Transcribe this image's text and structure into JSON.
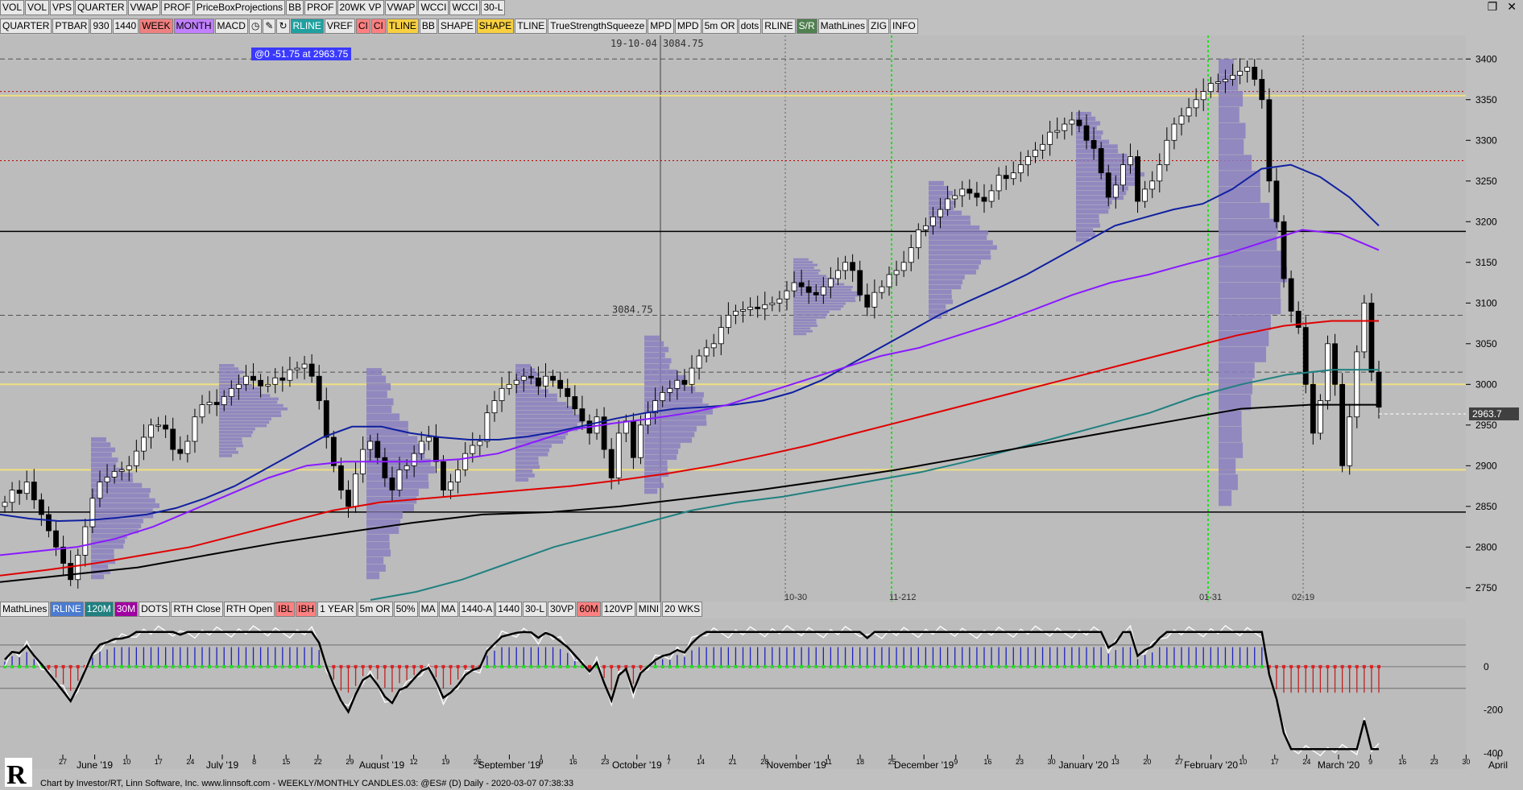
{
  "toolbar1": [
    "VOL",
    "VOL",
    "VPS",
    "QUARTER",
    "VWAP",
    "PROF",
    "PriceBoxProjections",
    "BB",
    "PROF",
    "20WK VP",
    "VWAP",
    "WCCI",
    "WCCI",
    "30-L"
  ],
  "toolbar2": [
    {
      "label": "QUARTER"
    },
    {
      "label": "PTBAR"
    },
    {
      "label": "930"
    },
    {
      "label": "1440"
    },
    {
      "label": "WEEK",
      "style": "c-red"
    },
    {
      "label": "MONTH",
      "style": "c-violet"
    },
    {
      "label": "MACD"
    },
    {
      "label": "clock-icon",
      "icon": "◷"
    },
    {
      "label": "pencil-icon",
      "icon": "✎"
    },
    {
      "label": "refresh-icon",
      "icon": "↻"
    },
    {
      "label": "RLINE",
      "style": "c-teal"
    },
    {
      "label": "VREF"
    },
    {
      "label": "CI",
      "style": "c-pink"
    },
    {
      "label": "CI",
      "style": "c-pink"
    },
    {
      "label": "TLINE",
      "style": "c-yellow"
    },
    {
      "label": "BB"
    },
    {
      "label": "SHAPE"
    },
    {
      "label": "SHAPE",
      "style": "c-yellow"
    },
    {
      "label": "TLINE"
    },
    {
      "label": "TrueStrengthSqueeze"
    },
    {
      "label": "MPD"
    },
    {
      "label": "MPD"
    },
    {
      "label": "5m OR"
    },
    {
      "label": "dots"
    },
    {
      "label": "RLINE"
    },
    {
      "label": "S/R",
      "style": "c-green"
    },
    {
      "label": "MathLines"
    },
    {
      "label": "ZIG"
    },
    {
      "label": "INFO"
    }
  ],
  "toolbar3": [
    {
      "label": "MathLines"
    },
    {
      "label": "RLINE",
      "style": "c-blue"
    },
    {
      "label": "120M",
      "style": "c-darkteal"
    },
    {
      "label": "30M",
      "style": "c-purple"
    },
    {
      "label": "DOTS"
    },
    {
      "label": "RTH Close"
    },
    {
      "label": "RTH Open"
    },
    {
      "label": "IBL",
      "style": "c-pink"
    },
    {
      "label": "IBH",
      "style": "c-pink"
    },
    {
      "label": "1 YEAR"
    },
    {
      "label": "5m OR"
    },
    {
      "label": "50%"
    },
    {
      "label": "MA"
    },
    {
      "label": "MA"
    },
    {
      "label": "1440-A"
    },
    {
      "label": "1440"
    },
    {
      "label": "30-L"
    },
    {
      "label": "30VP"
    },
    {
      "label": "60M",
      "style": "c-pink"
    },
    {
      "label": "120VP"
    },
    {
      "label": "MINI"
    },
    {
      "label": "20 WKS"
    }
  ],
  "info_badge": "@0  -51.75 at 2963.75",
  "cursor_label": "19-10-04  3084.75",
  "level_label": "3084.75",
  "current_price": "2963.7",
  "footer": "Chart by Investor/RT, Linn Software, Inc. www.linnsoft.com - WEEKLY/MONTHLY CANDLES.03: @ES# (D) Daily - 2020-03-07 07:38:33",
  "markers": [
    "10-30",
    "11-212",
    "01-31",
    "02-19"
  ],
  "colors": {
    "ma_blue": "#1020a0",
    "ma_violet": "#8a1aff",
    "ma_red": "#e00000",
    "ma_teal": "#208080",
    "ma_black": "#000000",
    "profile": "#8a7fc0",
    "guide_green": "#20e020"
  },
  "chart_data": [
    {
      "type": "candlestick",
      "title": "",
      "ylim": [
        2735,
        3425
      ],
      "yticks": [
        3400,
        3350,
        3300,
        3250,
        3200,
        3150,
        3100,
        3050,
        3000,
        2950,
        2900,
        2850,
        2800,
        2750
      ],
      "day_labels": [
        "27",
        "June '19",
        "10",
        "17",
        "24",
        "July '19",
        "8",
        "15",
        "22",
        "29",
        "August '19",
        "12",
        "19",
        "26",
        "September '19",
        "9",
        "16",
        "23",
        "October '19",
        "7",
        "14",
        "21",
        "28",
        "November '19",
        "11",
        "18",
        "25",
        "December '19",
        "9",
        "16",
        "23",
        "30",
        "January '20",
        "13",
        "20",
        "27",
        "February '20",
        "10",
        "17",
        "24",
        "March '20",
        "9",
        "16",
        "23",
        "30",
        "April"
      ],
      "closes": [
        2855,
        2870,
        2866,
        2880,
        2858,
        2840,
        2820,
        2800,
        2780,
        2760,
        2790,
        2825,
        2860,
        2880,
        2886,
        2893,
        2895,
        2900,
        2918,
        2935,
        2950,
        2950,
        2945,
        2920,
        2915,
        2930,
        2960,
        2975,
        2978,
        2975,
        2985,
        2995,
        3000,
        3010,
        3005,
        2998,
        3000,
        3008,
        3005,
        3018,
        3020,
        3025,
        3010,
        2980,
        2935,
        2900,
        2870,
        2850,
        2890,
        2920,
        2930,
        2910,
        2885,
        2870,
        2895,
        2900,
        2915,
        2930,
        2935,
        2905,
        2870,
        2880,
        2895,
        2915,
        2925,
        2930,
        2965,
        2980,
        2995,
        3000,
        3005,
        3010,
        3008,
        2998,
        3010,
        3005,
        2995,
        2985,
        2970,
        2955,
        2940,
        2960,
        2920,
        2885,
        2940,
        2955,
        2910,
        2950,
        2965,
        2980,
        2990,
        2995,
        3005,
        3000,
        3020,
        3035,
        3045,
        3050,
        3070,
        3085,
        3090,
        3092,
        3095,
        3093,
        3098,
        3100,
        3105,
        3115,
        3125,
        3120,
        3113,
        3110,
        3120,
        3130,
        3140,
        3150,
        3140,
        3110,
        3095,
        3113,
        3120,
        3135,
        3140,
        3150,
        3168,
        3190,
        3195,
        3206,
        3215,
        3228,
        3232,
        3240,
        3235,
        3230,
        3225,
        3238,
        3257,
        3253,
        3260,
        3270,
        3280,
        3288,
        3295,
        3310,
        3312,
        3320,
        3325,
        3318,
        3300,
        3290,
        3260,
        3230,
        3245,
        3270,
        3280,
        3225,
        3240,
        3250,
        3270,
        3300,
        3320,
        3330,
        3340,
        3350,
        3360,
        3370,
        3372,
        3375,
        3380,
        3385,
        3390,
        3375,
        3350,
        3250,
        3200,
        3130,
        3090,
        3070,
        3000,
        2940,
        2980,
        3050,
        3000,
        2900,
        2960,
        3040,
        3100,
        3015,
        2972
      ],
      "ma_blue": [
        2840,
        2835,
        2832,
        2833,
        2836,
        2840,
        2848,
        2860,
        2875,
        2895,
        2915,
        2935,
        2948,
        2948,
        2940,
        2935,
        2932,
        2932,
        2936,
        2942,
        2950,
        2958,
        2965,
        2970,
        2972,
        2975,
        2980,
        2990,
        3005,
        3025,
        3045,
        3065,
        3085,
        3102,
        3118,
        3135,
        3155,
        3175,
        3195,
        3205,
        3215,
        3222,
        3240,
        3265,
        3270,
        3255,
        3230,
        3195
      ],
      "ma_violet": [
        2790,
        2795,
        2800,
        2810,
        2825,
        2845,
        2865,
        2885,
        2900,
        2905,
        2905,
        2905,
        2908,
        2915,
        2930,
        2945,
        2952,
        2958,
        2965,
        2975,
        2990,
        3005,
        3020,
        3035,
        3045,
        3060,
        3075,
        3092,
        3110,
        3125,
        3135,
        3148,
        3160,
        3175,
        3190,
        3185,
        3165
      ],
      "ma_red": [
        2765,
        2772,
        2780,
        2790,
        2800,
        2815,
        2830,
        2845,
        2855,
        2860,
        2865,
        2870,
        2875,
        2882,
        2890,
        2900,
        2912,
        2925,
        2940,
        2955,
        2970,
        2985,
        3000,
        3015,
        3030,
        3045,
        3060,
        3072,
        3078,
        3078
      ],
      "ma_teal": [
        2735,
        2745,
        2760,
        2780,
        2800,
        2815,
        2830,
        2845,
        2855,
        2862,
        2872,
        2882,
        2892,
        2905,
        2920,
        2935,
        2950,
        2965,
        2985,
        3000,
        3012,
        3018,
        3018
      ],
      "ma_black": [
        2757,
        2766,
        2775,
        2790,
        2805,
        2818,
        2830,
        2840,
        2843,
        2850,
        2860,
        2870,
        2882,
        2895,
        2910,
        2925,
        2940,
        2955,
        2970,
        2975,
        2975
      ],
      "osc_ylim": [
        -420,
        200
      ],
      "osc_yticks": [
        0,
        -200,
        -400
      ]
    }
  ]
}
